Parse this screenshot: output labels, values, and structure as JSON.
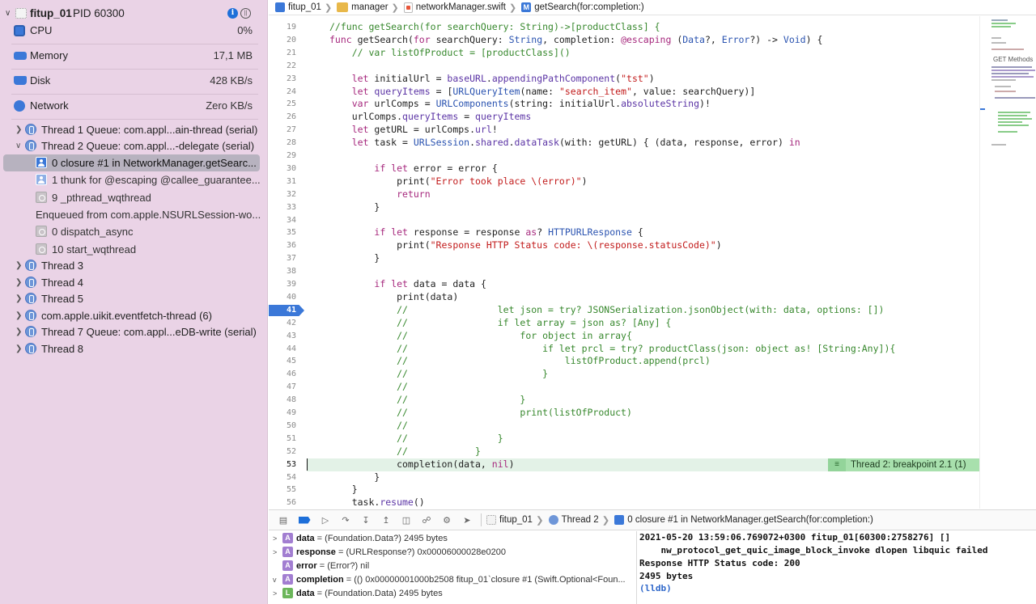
{
  "process": {
    "name": "fitup_01",
    "pid": "PID 60300"
  },
  "gauges": [
    {
      "label": "CPU",
      "value": "0%",
      "icon": "cpu-icon",
      "color": "#3b78d8"
    },
    {
      "label": "Memory",
      "value": "17,1 MB",
      "icon": "memory-icon",
      "color": "#3b78d8"
    },
    {
      "label": "Disk",
      "value": "428 KB/s",
      "icon": "disk-icon",
      "color": "#3b78d8"
    },
    {
      "label": "Network",
      "value": "Zero KB/s",
      "icon": "network-icon",
      "color": "#3b78d8"
    }
  ],
  "threads": {
    "t1": "Thread 1 Queue: com.appl...ain-thread (serial)",
    "t2": "Thread 2 Queue: com.appl...-delegate (serial)",
    "t3": "Thread 3",
    "t4": "Thread 4",
    "t5": "Thread 5",
    "t6": "com.apple.uikit.eventfetch-thread (6)",
    "t7": "Thread 7 Queue: com.appl...eDB-write (serial)",
    "t8": "Thread 8"
  },
  "frames": {
    "f0": "0 closure #1 in NetworkManager.getSearc...",
    "f1": "1 thunk for @escaping @callee_guarantee...",
    "f9": "9 _pthread_wqthread",
    "enqueued": "Enqueued from com.apple.NSURLSession-wo...",
    "d0": "0 dispatch_async",
    "d10": "10 start_wqthread"
  },
  "breadcrumb": {
    "project": "fitup_01",
    "group": "manager",
    "file": "networkManager.swift",
    "symbol": "getSearch(for:completion:)",
    "symbol_badge": "M"
  },
  "editor": {
    "current_line": "41",
    "breakpoint_line": "41",
    "breakpoint_badge": "Thread 2: breakpoint 2.1 (1)",
    "lines": [
      {
        "n": "19",
        "text": "    //func getSearch(for searchQuery: String)->[productClass] {"
      },
      {
        "n": "20",
        "text": "    func getSearch(for searchQuery: String, completion: @escaping (Data?, Error?) -> Void) {"
      },
      {
        "n": "21",
        "text": "        // var listOfProduct = [productClass]()"
      },
      {
        "n": "22",
        "text": ""
      },
      {
        "n": "23",
        "text": "        let initialUrl = baseURL.appendingPathComponent(\"tst\")"
      },
      {
        "n": "24",
        "text": "        let queryItems = [URLQueryItem(name: \"search_item\", value: searchQuery)]"
      },
      {
        "n": "25",
        "text": "        var urlComps = URLComponents(string: initialUrl.absoluteString)!"
      },
      {
        "n": "26",
        "text": "        urlComps.queryItems = queryItems"
      },
      {
        "n": "27",
        "text": "        let getURL = urlComps.url!"
      },
      {
        "n": "28",
        "text": "        let task = URLSession.shared.dataTask(with: getURL) { (data, response, error) in"
      },
      {
        "n": "29",
        "text": ""
      },
      {
        "n": "30",
        "text": "            if let error = error {"
      },
      {
        "n": "31",
        "text": "                print(\"Error took place \\(error)\")"
      },
      {
        "n": "32",
        "text": "                return"
      },
      {
        "n": "33",
        "text": "            }"
      },
      {
        "n": "34",
        "text": ""
      },
      {
        "n": "35",
        "text": "            if let response = response as? HTTPURLResponse {"
      },
      {
        "n": "36",
        "text": "                print(\"Response HTTP Status code: \\(response.statusCode)\")"
      },
      {
        "n": "37",
        "text": "            }"
      },
      {
        "n": "38",
        "text": ""
      },
      {
        "n": "39",
        "text": "            if let data = data {"
      },
      {
        "n": "40",
        "text": "                print(data)"
      },
      {
        "n": "41",
        "text": "                //                let json = try? JSONSerialization.jsonObject(with: data, options: [])"
      },
      {
        "n": "42",
        "text": "                //                if let array = json as? [Any] {"
      },
      {
        "n": "43",
        "text": "                //                    for object in array{"
      },
      {
        "n": "44",
        "text": "                //                        if let prcl = try? productClass(json: object as! [String:Any]){"
      },
      {
        "n": "45",
        "text": "                //                            listOfProduct.append(prcl)"
      },
      {
        "n": "46",
        "text": "                //                        }"
      },
      {
        "n": "47",
        "text": "                //"
      },
      {
        "n": "48",
        "text": "                //                    }"
      },
      {
        "n": "49",
        "text": "                //                    print(listOfProduct)"
      },
      {
        "n": "50",
        "text": "                //"
      },
      {
        "n": "51",
        "text": "                //                }"
      },
      {
        "n": "52",
        "text": "                //            }"
      },
      {
        "n": "53",
        "text": "                completion(data, nil)"
      },
      {
        "n": "54",
        "text": "            }"
      },
      {
        "n": "55",
        "text": "        }"
      },
      {
        "n": "56",
        "text": "        task.resume()"
      }
    ]
  },
  "minimap": {
    "label": "GET Methods"
  },
  "debugbar": {
    "project": "fitup_01",
    "thread": "Thread 2",
    "frame": "0 closure #1 in NetworkManager.getSearch(for:completion:)"
  },
  "variables": [
    {
      "badge": "A",
      "name": "data",
      "value": " = (Foundation.Data?) 2495 bytes",
      "disclosure": ">"
    },
    {
      "badge": "A",
      "name": "response",
      "value": " = (URLResponse?) 0x00006000028e0200",
      "disclosure": ">"
    },
    {
      "badge": "A",
      "name": "error",
      "value": " = (Error?) nil",
      "disclosure": ""
    },
    {
      "badge": "A",
      "name": "completion",
      "value": " = (() 0x00000001000b2508 fitup_01`closure #1 (Swift.Optional<Foun...",
      "disclosure": "v"
    },
    {
      "badge": "L",
      "name": "data",
      "value": " = (Foundation.Data) 2495 bytes",
      "disclosure": ">"
    }
  ],
  "console": [
    "2021-05-20 13:59:06.769072+0300 fitup_01[60300:2758276] []",
    "    nw_protocol_get_quic_image_block_invoke dlopen libquic failed",
    "Response HTTP Status code: 200",
    "2495 bytes",
    "(lldb)"
  ],
  "colors": {
    "accent": "#1e6fd9",
    "sidebar_bg": "#ead3e6",
    "breakpoint": "#3b78d8",
    "highlight_line": "#e3f2e7"
  }
}
